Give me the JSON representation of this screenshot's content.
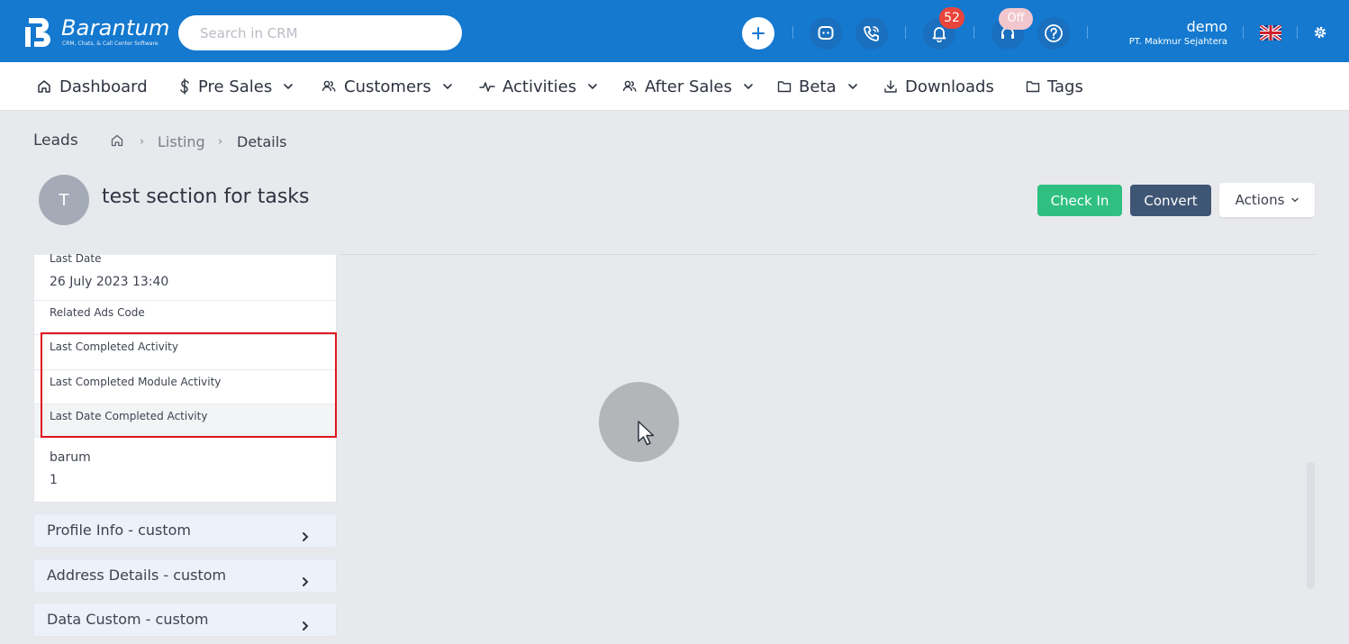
{
  "app": {
    "brand_name": "Barantum",
    "brand_tagline": "CRM, Chats, & Call Center Software",
    "colors": {
      "topbar": "#1479cf",
      "success": "#2fc081",
      "primary_dark": "#3f5574",
      "highlight": "#e0151d",
      "badge": "#e9443b"
    }
  },
  "topbar": {
    "search_placeholder": "Search in CRM",
    "notification_count": "52",
    "call_status": "Off",
    "user_name": "demo",
    "user_org": "PT. Makmur Sejahtera",
    "icons": [
      "plus-icon",
      "chat-icon",
      "phone-call-icon",
      "bell-icon",
      "headset-icon",
      "help-icon",
      "uk-flag-icon",
      "gear-icon"
    ]
  },
  "nav": {
    "items": [
      {
        "label": "Dashboard",
        "icon": "home-icon",
        "dropdown": false
      },
      {
        "label": "Pre Sales",
        "icon": "dollar-icon",
        "dropdown": true
      },
      {
        "label": "Customers",
        "icon": "users-icon",
        "dropdown": true
      },
      {
        "label": "Activities",
        "icon": "activity-icon",
        "dropdown": true
      },
      {
        "label": "After Sales",
        "icon": "users-icon",
        "dropdown": true
      },
      {
        "label": "Beta",
        "icon": "folder-icon",
        "dropdown": true
      },
      {
        "label": "Downloads",
        "icon": "download-icon",
        "dropdown": false
      },
      {
        "label": "Tags",
        "icon": "folder-icon",
        "dropdown": false
      }
    ]
  },
  "breadcrumb": {
    "title": "Leads",
    "listing": "Listing",
    "current": "Details"
  },
  "record": {
    "avatar_initial": "T",
    "title": "test section for tasks",
    "checkin_label": "Check In",
    "convert_label": "Convert",
    "actions_label": "Actions"
  },
  "details": {
    "last_date_label": "Last Date",
    "last_date_value": "26 July 2023 13:40",
    "related_ads_code_label": "Related Ads Code",
    "last_completed_activity_label": "Last Completed Activity",
    "last_completed_module_activity_label": "Last Completed Module Activity",
    "last_date_completed_activity_label": "Last Date Completed Activity",
    "barum_label": "barum",
    "barum_value": "1"
  },
  "sections": [
    {
      "label": "Profile Info - custom"
    },
    {
      "label": "Address Details - custom"
    },
    {
      "label": "Data Custom - custom"
    }
  ]
}
